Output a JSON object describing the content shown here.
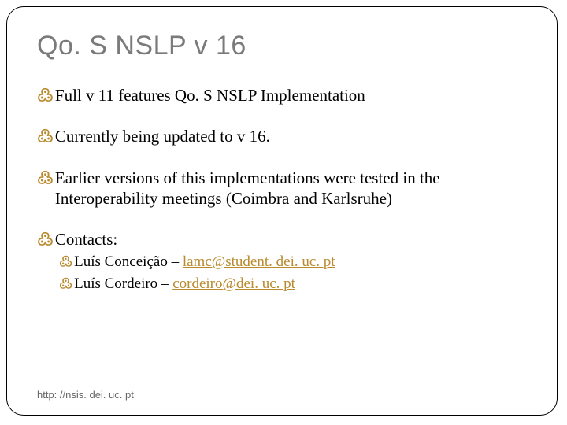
{
  "title": "Qo. S NSLP v 16",
  "bullets": {
    "b1": "Full v 11 features Qo. S NSLP Implementation",
    "b2": "Currently being updated to v 16.",
    "b3": "Earlier versions of this implementations were tested in the Interoperability meetings (Coimbra and Karlsruhe)",
    "b4": "Contacts:"
  },
  "contacts": {
    "c1_name": "Luís Conceição – ",
    "c1_email": "lamc@student. dei. uc. pt",
    "c2_name": "Luís Cordeiro – ",
    "c2_email": "cordeiro@dei. uc. pt"
  },
  "footer": "http: //nsis. dei. uc. pt",
  "glyph": "་⸥"
}
